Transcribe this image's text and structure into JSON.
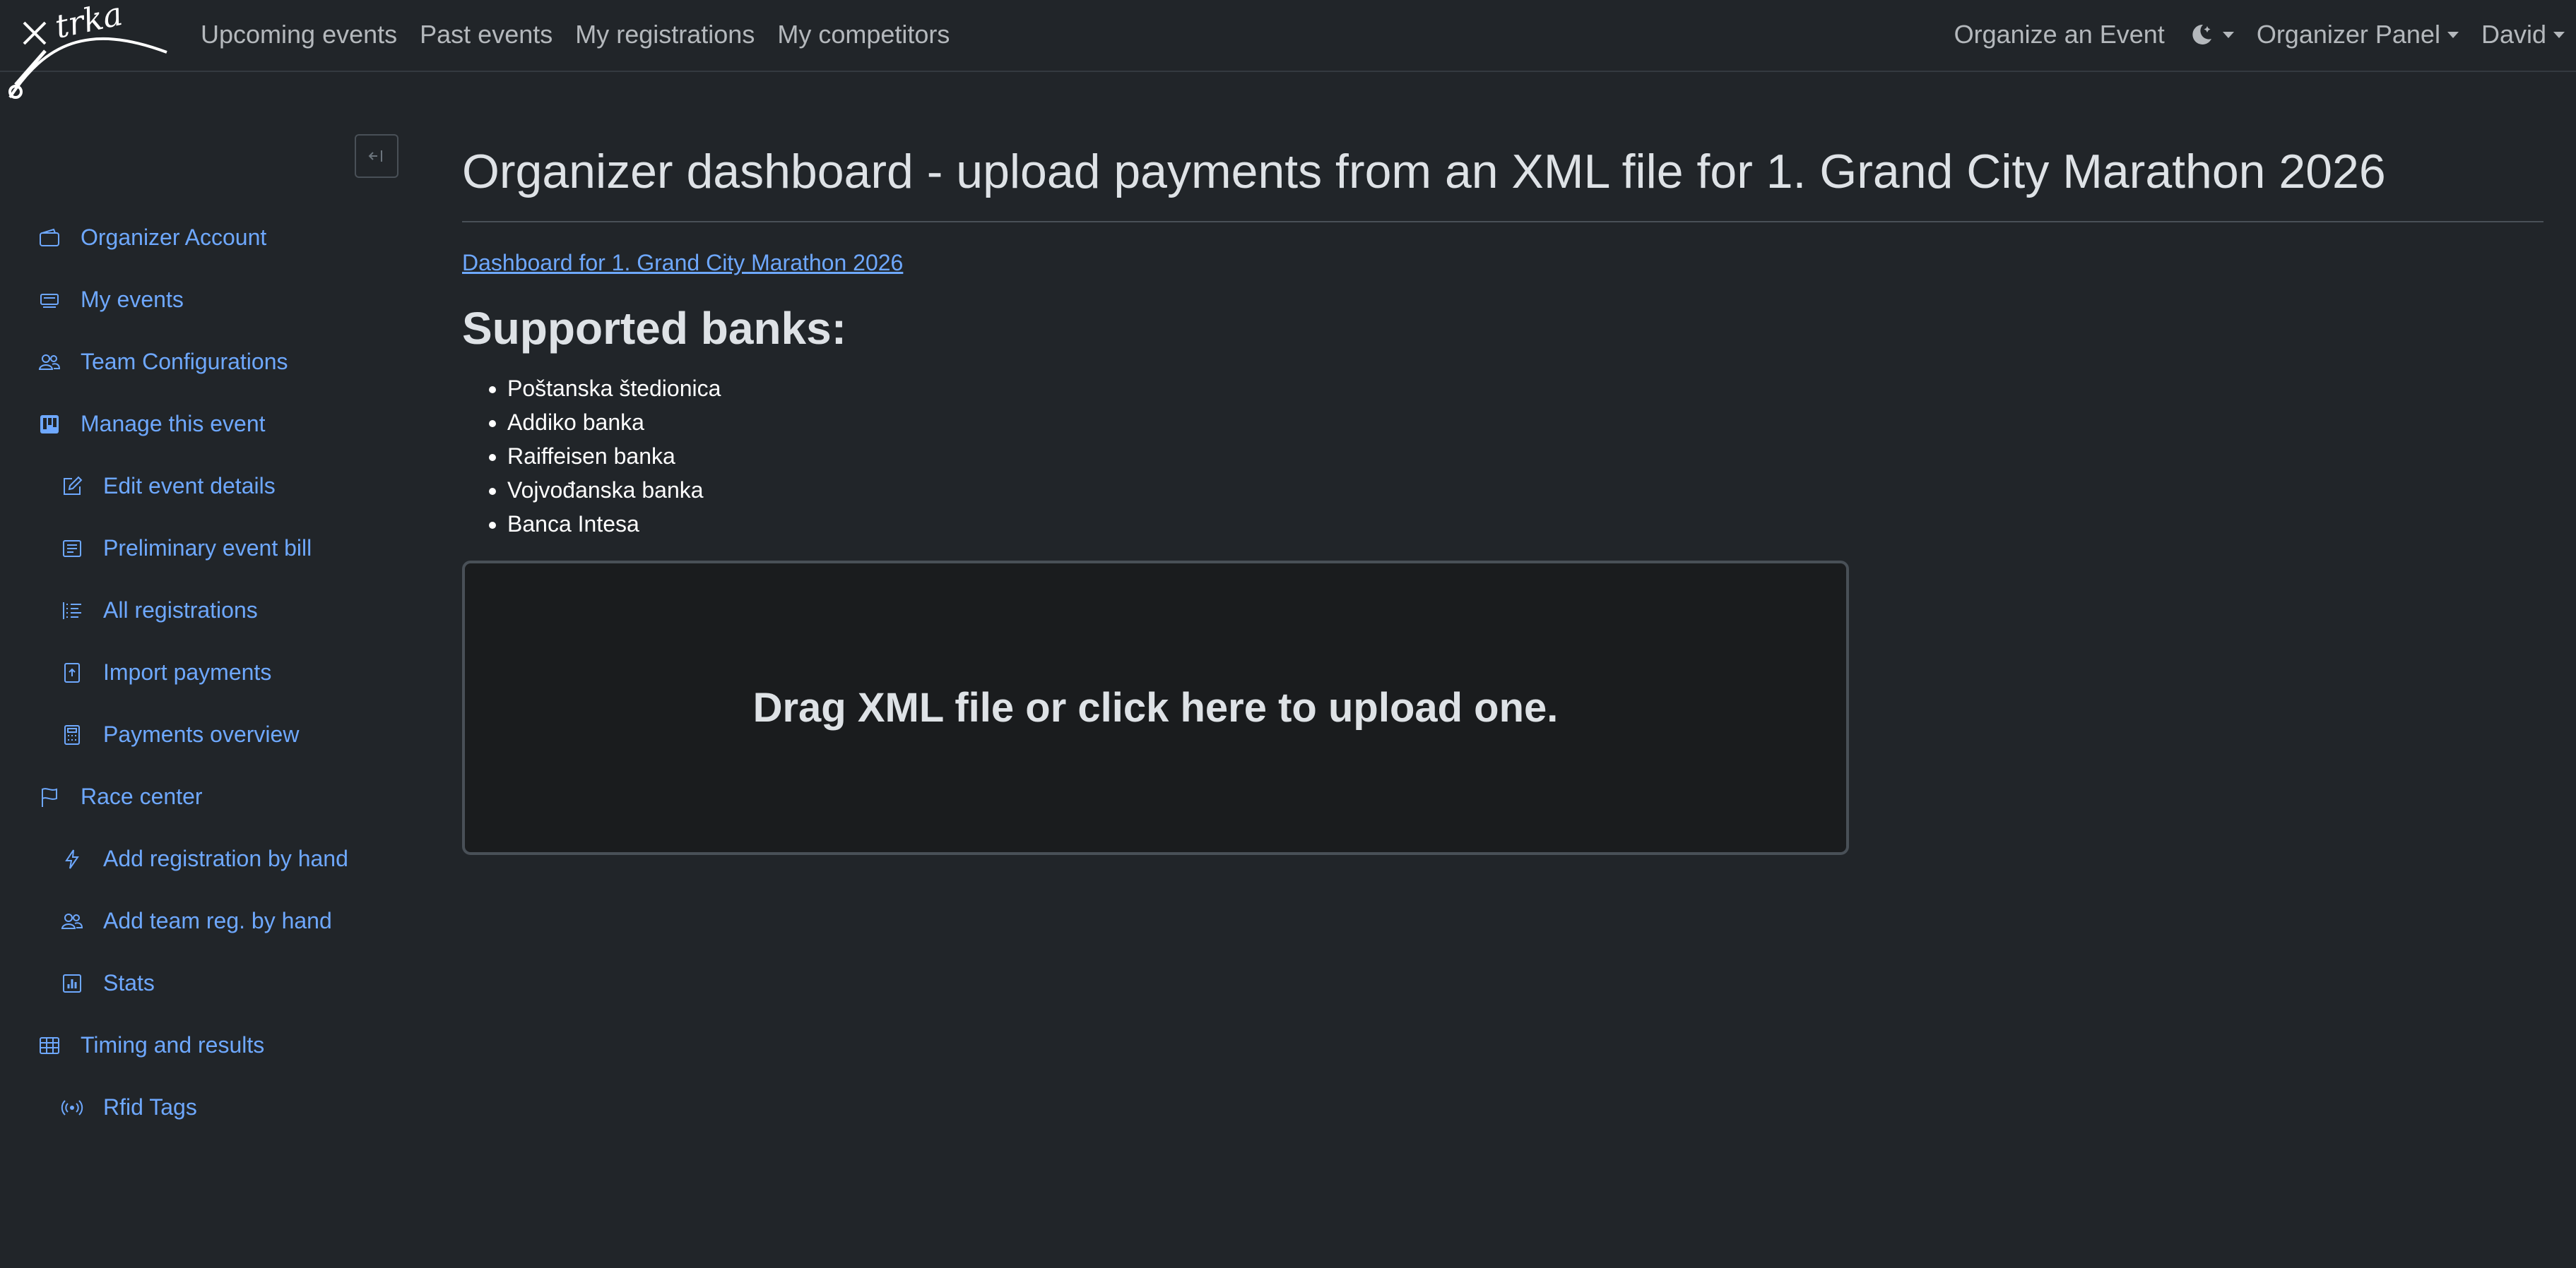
{
  "navbar": {
    "logo_text": "trka",
    "links": [
      "Upcoming events",
      "Past events",
      "My registrations",
      "My competitors"
    ],
    "organize": "Organize an Event",
    "organizer_panel": "Organizer Panel",
    "user": "David"
  },
  "sidebar": {
    "toggle_icon": "collapse-left-icon",
    "items": [
      {
        "label": "Organizer Account",
        "icon": "wallet-icon"
      },
      {
        "label": "My events",
        "icon": "card-icon"
      },
      {
        "label": "Team Configurations",
        "icon": "people-icon"
      },
      {
        "label": "Manage this event",
        "icon": "kanban-icon"
      },
      {
        "label": "Edit event details",
        "icon": "pencil-square-icon"
      },
      {
        "label": "Preliminary event bill",
        "icon": "receipt-icon"
      },
      {
        "label": "All registrations",
        "icon": "list-ol-icon"
      },
      {
        "label": "Import payments",
        "icon": "file-upload-icon"
      },
      {
        "label": "Payments overview",
        "icon": "calculator-icon"
      },
      {
        "label": "Race center",
        "icon": "flag-icon"
      },
      {
        "label": "Add registration by hand",
        "icon": "lightning-icon"
      },
      {
        "label": "Add team reg. by hand",
        "icon": "people-icon"
      },
      {
        "label": "Stats",
        "icon": "bar-chart-icon"
      },
      {
        "label": "Timing and results",
        "icon": "table-icon"
      },
      {
        "label": "Rfid Tags",
        "icon": "broadcast-icon"
      }
    ]
  },
  "main": {
    "title": "Organizer dashboard - upload payments from an XML file for 1. Grand City Marathon 2026",
    "dashboard_link": "Dashboard for 1. Grand City Marathon 2026",
    "banks_heading": "Supported banks:",
    "banks": [
      "Poštanska štedionica",
      "Addiko banka",
      "Raiffeisen banka",
      "Vojvođanska banka",
      "Banca Intesa"
    ],
    "dropzone_text": "Drag XML file or click here to upload one."
  },
  "colors": {
    "background": "#212529",
    "link": "#6ea8fe",
    "text": "#dee2e6",
    "border": "#495057"
  }
}
